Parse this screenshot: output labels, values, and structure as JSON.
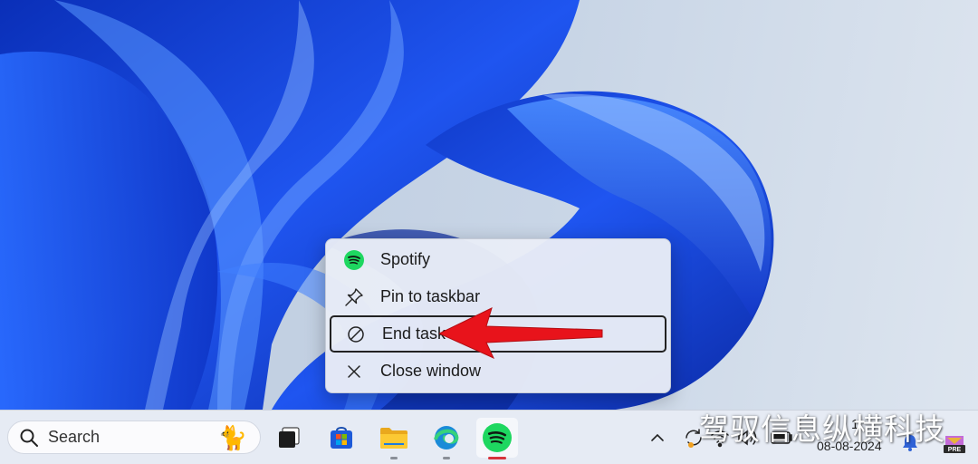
{
  "context_menu": {
    "items": [
      {
        "label": "Spotify",
        "icon": "spotify-icon"
      },
      {
        "label": "Pin to taskbar",
        "icon": "pin-icon"
      },
      {
        "label": "End task",
        "icon": "prohibited-icon",
        "highlighted": true
      },
      {
        "label": "Close window",
        "icon": "close-icon"
      }
    ]
  },
  "taskbar": {
    "search_label": "Search",
    "search_icon": "search-icon",
    "search_highlight": "cat-icon",
    "apps": [
      {
        "name": "task-view",
        "icon": "task-view-icon"
      },
      {
        "name": "microsoft-store",
        "icon": "store-icon"
      },
      {
        "name": "file-explorer",
        "icon": "folder-icon"
      },
      {
        "name": "edge",
        "icon": "edge-icon"
      },
      {
        "name": "spotify",
        "icon": "spotify-icon",
        "active": true
      }
    ]
  },
  "tray": {
    "time": "1",
    "date": "08-08-2024",
    "icons": [
      "chevron-up-icon",
      "sync-icon",
      "wifi-icon",
      "volume-icon",
      "battery-icon",
      "bell-icon"
    ],
    "badge": "PRE"
  },
  "watermark": "驾驭信息纵横科技",
  "colors": {
    "spotify_green": "#1ed760",
    "arrow_red": "#e8131b",
    "wallpaper_blue": "#1540d8",
    "highlight_border": "#222222"
  }
}
